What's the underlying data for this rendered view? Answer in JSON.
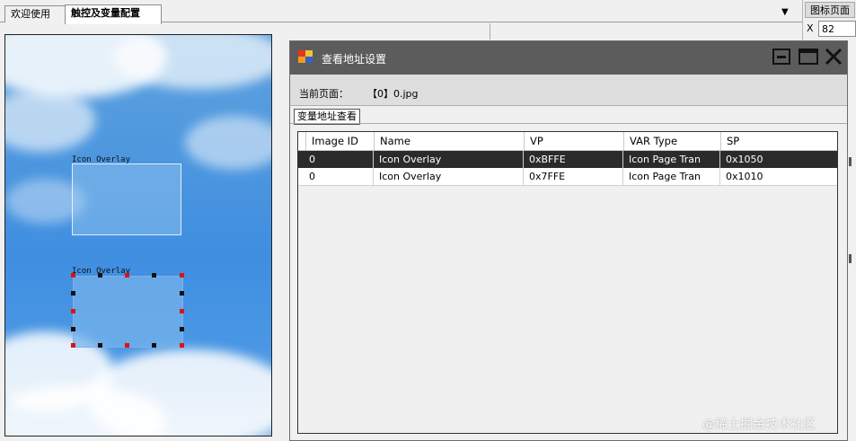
{
  "tabs": [
    {
      "label": "欢迎使用"
    },
    {
      "label": "触控及变量配置"
    }
  ],
  "right_panel": {
    "title": "图标页面",
    "x_label": "X",
    "x_value": "82"
  },
  "canvas": {
    "overlays": [
      {
        "label": "Icon Overlay"
      },
      {
        "label": "Icon Overlay"
      }
    ]
  },
  "dialog": {
    "title": "查看地址设置",
    "current_page_label": "当前页面：",
    "current_page_value": "【0】0.jpg",
    "subtab": "变量地址查看",
    "columns": [
      "Image ID",
      "Name",
      "VP",
      "VAR Type",
      "SP"
    ],
    "rows": [
      {
        "image_id": "0",
        "name": "Icon Overlay",
        "vp": "0xBFFE",
        "var_type": "Icon Page Tran",
        "sp": "0x1050"
      },
      {
        "image_id": "0",
        "name": "Icon Overlay",
        "vp": "0x7FFE",
        "var_type": "Icon Page Tran",
        "sp": "0x1010"
      }
    ]
  },
  "watermark": "@稀土掘金技术社区"
}
